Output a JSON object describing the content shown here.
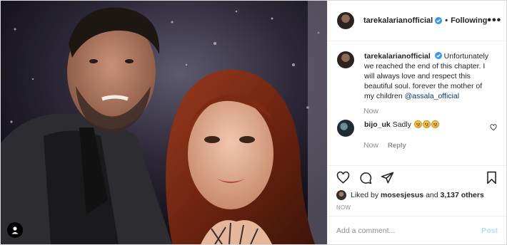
{
  "header": {
    "username": "tarekalarianofficial",
    "separator": "•",
    "follow_status": "Following",
    "more_label": "•••"
  },
  "caption": {
    "username": "tarekalarianofficial",
    "text": "Unfortunately we reached the end of this chapter. I will always love and respect this beautiful soul. forever the mother of my children",
    "mention": "@assala_official",
    "time": "Now"
  },
  "comments": [
    {
      "username": "bijo_uk",
      "text": "Sadly",
      "emoji": [
        "sad-face",
        "sad-face",
        "sad-face"
      ],
      "time": "Now",
      "reply_label": "Reply"
    }
  ],
  "likes": {
    "prefix": "Liked by",
    "user": "mosesjesus",
    "joiner": "and",
    "others": "3,137 others"
  },
  "timestamp": "NOW",
  "add_comment": {
    "placeholder": "Add a comment...",
    "post_label": "Post"
  },
  "colors": {
    "verified": "#3897f0",
    "link": "#00376b",
    "post_disabled": "#b2dffc",
    "muted": "#8e8e8e"
  }
}
